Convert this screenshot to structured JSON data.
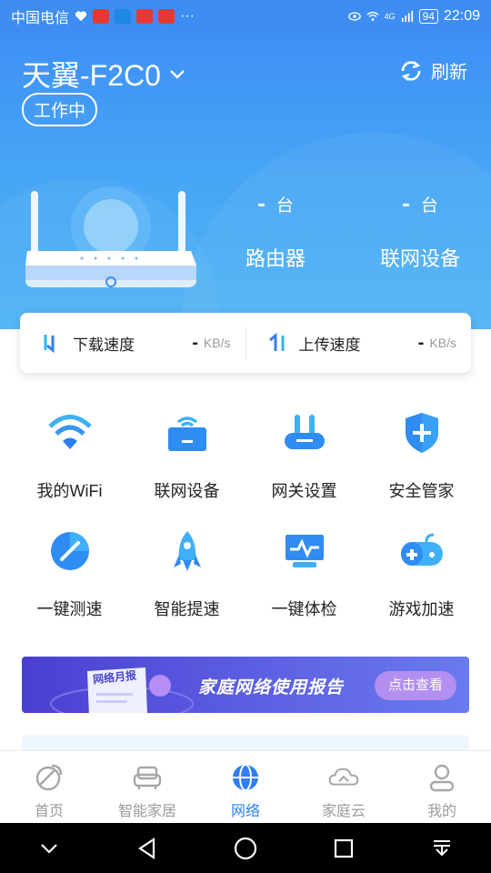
{
  "status_bar": {
    "carrier": "中国电信",
    "battery": "94",
    "time": "22:09",
    "network": "4G",
    "more": "···"
  },
  "header": {
    "device_name": "天翼-F2C0",
    "status": "工作中",
    "refresh_label": "刷新"
  },
  "stats": [
    {
      "value": "-",
      "unit": "台",
      "label": "路由器"
    },
    {
      "value": "-",
      "unit": "台",
      "label": "联网设备"
    }
  ],
  "speed": {
    "download": {
      "label": "下载速度",
      "value": "-",
      "unit": "KB/s"
    },
    "upload": {
      "label": "上传速度",
      "value": "-",
      "unit": "KB/s"
    }
  },
  "features": [
    {
      "label": "我的WiFi",
      "icon": "wifi-icon"
    },
    {
      "label": "联网设备",
      "icon": "devices-icon"
    },
    {
      "label": "网关设置",
      "icon": "gateway-icon"
    },
    {
      "label": "安全管家",
      "icon": "shield-icon"
    },
    {
      "label": "一键测速",
      "icon": "speedometer-icon"
    },
    {
      "label": "智能提速",
      "icon": "rocket-icon"
    },
    {
      "label": "一键体检",
      "icon": "checkup-icon"
    },
    {
      "label": "游戏加速",
      "icon": "gamepad-icon"
    }
  ],
  "banner": {
    "doc_label": "网络月报",
    "title": "家庭网络使用报告",
    "button": "点击查看"
  },
  "tabs": [
    {
      "label": "首页",
      "icon": "home-icon",
      "active": false
    },
    {
      "label": "智能家居",
      "icon": "sofa-icon",
      "active": false
    },
    {
      "label": "网络",
      "icon": "globe-icon",
      "active": true
    },
    {
      "label": "家庭云",
      "icon": "cloud-icon",
      "active": false
    },
    {
      "label": "我的",
      "icon": "user-icon",
      "active": false
    }
  ],
  "colors": {
    "primary": "#3f90f5",
    "accent_active": "#2f7ff3",
    "banner": "#4b3fd1"
  }
}
